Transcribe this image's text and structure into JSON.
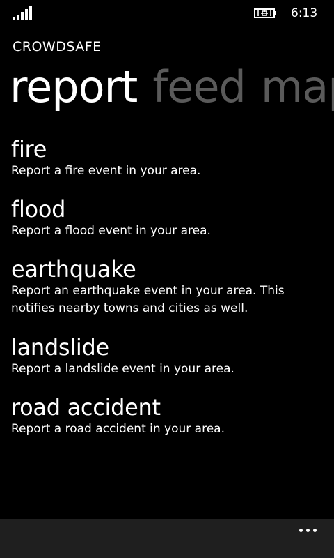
{
  "status": {
    "time": "6:13",
    "signal_icon": "signal-strength-icon",
    "battery_icon": "battery-charging-icon"
  },
  "app": {
    "title": "CROWDSAFE"
  },
  "pivot": {
    "tabs": [
      {
        "label": "report",
        "active": true
      },
      {
        "label": "feed",
        "active": false
      },
      {
        "label": "map",
        "active": false
      }
    ]
  },
  "report_items": [
    {
      "title": "fire",
      "description": "Report a fire event in your area."
    },
    {
      "title": "flood",
      "description": "Report a flood event in your area."
    },
    {
      "title": "earthquake",
      "description": "Report an earthquake event in your area. This notifies nearby towns and cities as well."
    },
    {
      "title": "landslide",
      "description": "Report a landslide event in your area."
    },
    {
      "title": "road accident",
      "description": "Report a road accident in your area."
    }
  ],
  "app_bar": {
    "more_icon": "more-ellipsis-icon"
  },
  "colors": {
    "background": "#000000",
    "text": "#ffffff",
    "inactive_tab": "#5a5a5a",
    "app_bar": "#1f1f1f"
  }
}
